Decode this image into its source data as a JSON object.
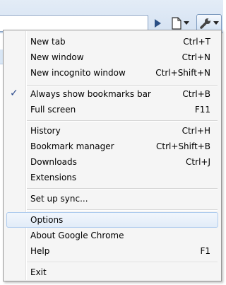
{
  "menu": {
    "items": [
      {
        "label": "New tab",
        "shortcut": "Ctrl+T"
      },
      {
        "label": "New window",
        "shortcut": "Ctrl+N"
      },
      {
        "label": "New incognito window",
        "shortcut": "Ctrl+Shift+N"
      },
      {
        "label": "Always show bookmarks bar",
        "shortcut": "Ctrl+B",
        "checked": true
      },
      {
        "label": "Full screen",
        "shortcut": "F11"
      },
      {
        "label": "History",
        "shortcut": "Ctrl+H"
      },
      {
        "label": "Bookmark manager",
        "shortcut": "Ctrl+Shift+B"
      },
      {
        "label": "Downloads",
        "shortcut": "Ctrl+J"
      },
      {
        "label": "Extensions",
        "shortcut": ""
      },
      {
        "label": "Set up sync...",
        "shortcut": ""
      },
      {
        "label": "Options",
        "shortcut": "",
        "highlighted": true
      },
      {
        "label": "About Google Chrome",
        "shortcut": ""
      },
      {
        "label": "Help",
        "shortcut": "F1"
      },
      {
        "label": "Exit",
        "shortcut": ""
      }
    ],
    "check_mark": "✓"
  },
  "toolbar": {
    "icons": [
      "play-icon",
      "page-icon",
      "wrench-icon"
    ]
  },
  "colors": {
    "highlight_border": "#aecbee",
    "check": "#2b4a8c"
  }
}
